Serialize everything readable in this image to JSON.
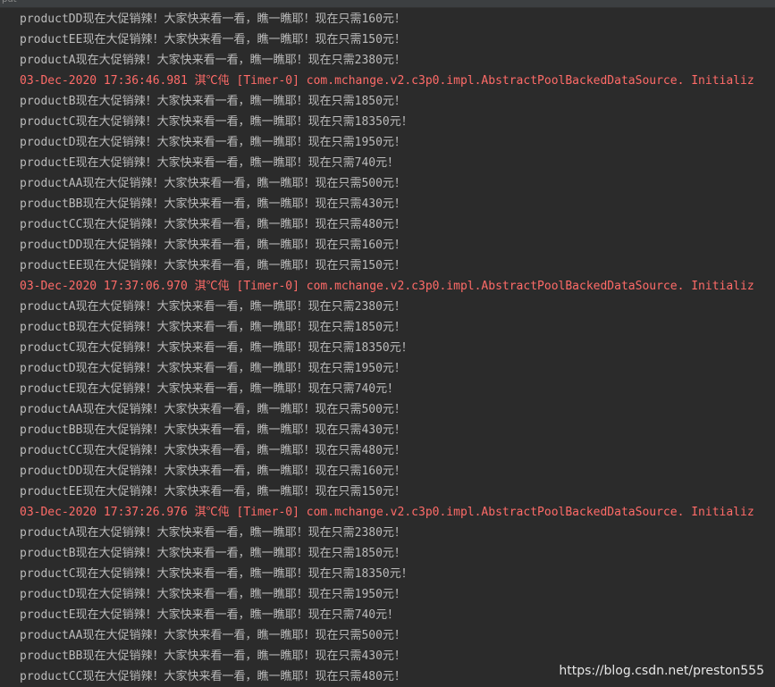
{
  "window": {
    "tab_title": "put"
  },
  "colors": {
    "background": "#2b2b2b",
    "stdout": "#bbbbbb",
    "stderr": "#ff6b68"
  },
  "console_lines": [
    {
      "text": "productDD现在大促销辣！大家快来看一看，瞧一瞧耶！现在只需160元！",
      "type": "out"
    },
    {
      "text": "productEE现在大促销辣！大家快来看一看，瞧一瞧耶！现在只需150元！",
      "type": "out"
    },
    {
      "text": "productA现在大促销辣！大家快来看一看，瞧一瞧耶！现在只需2380元！",
      "type": "out"
    },
    {
      "text": "03-Dec-2020 17:36:46.981 淇℃伅 [Timer-0] com.mchange.v2.c3p0.impl.AbstractPoolBackedDataSource. Initializ",
      "type": "err"
    },
    {
      "text": "productB现在大促销辣！大家快来看一看，瞧一瞧耶！现在只需1850元！",
      "type": "out"
    },
    {
      "text": "productC现在大促销辣！大家快来看一看，瞧一瞧耶！现在只需18350元！",
      "type": "out"
    },
    {
      "text": "productD现在大促销辣！大家快来看一看，瞧一瞧耶！现在只需1950元！",
      "type": "out"
    },
    {
      "text": "productE现在大促销辣！大家快来看一看，瞧一瞧耶！现在只需740元！",
      "type": "out"
    },
    {
      "text": "productAA现在大促销辣！大家快来看一看，瞧一瞧耶！现在只需500元！",
      "type": "out"
    },
    {
      "text": "productBB现在大促销辣！大家快来看一看，瞧一瞧耶！现在只需430元！",
      "type": "out"
    },
    {
      "text": "productCC现在大促销辣！大家快来看一看，瞧一瞧耶！现在只需480元！",
      "type": "out"
    },
    {
      "text": "productDD现在大促销辣！大家快来看一看，瞧一瞧耶！现在只需160元！",
      "type": "out"
    },
    {
      "text": "productEE现在大促销辣！大家快来看一看，瞧一瞧耶！现在只需150元！",
      "type": "out"
    },
    {
      "text": "03-Dec-2020 17:37:06.970 淇℃伅 [Timer-0] com.mchange.v2.c3p0.impl.AbstractPoolBackedDataSource. Initializ",
      "type": "err"
    },
    {
      "text": "productA现在大促销辣！大家快来看一看，瞧一瞧耶！现在只需2380元！",
      "type": "out"
    },
    {
      "text": "productB现在大促销辣！大家快来看一看，瞧一瞧耶！现在只需1850元！",
      "type": "out"
    },
    {
      "text": "productC现在大促销辣！大家快来看一看，瞧一瞧耶！现在只需18350元！",
      "type": "out"
    },
    {
      "text": "productD现在大促销辣！大家快来看一看，瞧一瞧耶！现在只需1950元！",
      "type": "out"
    },
    {
      "text": "productE现在大促销辣！大家快来看一看，瞧一瞧耶！现在只需740元！",
      "type": "out"
    },
    {
      "text": "productAA现在大促销辣！大家快来看一看，瞧一瞧耶！现在只需500元！",
      "type": "out"
    },
    {
      "text": "productBB现在大促销辣！大家快来看一看，瞧一瞧耶！现在只需430元！",
      "type": "out"
    },
    {
      "text": "productCC现在大促销辣！大家快来看一看，瞧一瞧耶！现在只需480元！",
      "type": "out"
    },
    {
      "text": "productDD现在大促销辣！大家快来看一看，瞧一瞧耶！现在只需160元！",
      "type": "out"
    },
    {
      "text": "productEE现在大促销辣！大家快来看一看，瞧一瞧耶！现在只需150元！",
      "type": "out"
    },
    {
      "text": "03-Dec-2020 17:37:26.976 淇℃伅 [Timer-0] com.mchange.v2.c3p0.impl.AbstractPoolBackedDataSource. Initializ",
      "type": "err"
    },
    {
      "text": "productA现在大促销辣！大家快来看一看，瞧一瞧耶！现在只需2380元！",
      "type": "out"
    },
    {
      "text": "productB现在大促销辣！大家快来看一看，瞧一瞧耶！现在只需1850元！",
      "type": "out"
    },
    {
      "text": "productC现在大促销辣！大家快来看一看，瞧一瞧耶！现在只需18350元！",
      "type": "out"
    },
    {
      "text": "productD现在大促销辣！大家快来看一看，瞧一瞧耶！现在只需1950元！",
      "type": "out"
    },
    {
      "text": "productE现在大促销辣！大家快来看一看，瞧一瞧耶！现在只需740元！",
      "type": "out"
    },
    {
      "text": "productAA现在大促销辣！大家快来看一看，瞧一瞧耶！现在只需500元！",
      "type": "out"
    },
    {
      "text": "productBB现在大促销辣！大家快来看一看，瞧一瞧耶！现在只需430元！",
      "type": "out"
    },
    {
      "text": "productCC现在大促销辣！大家快来看一看，瞧一瞧耶！现在只需480元！",
      "type": "out"
    }
  ],
  "watermark": "https://blog.csdn.net/preston555"
}
